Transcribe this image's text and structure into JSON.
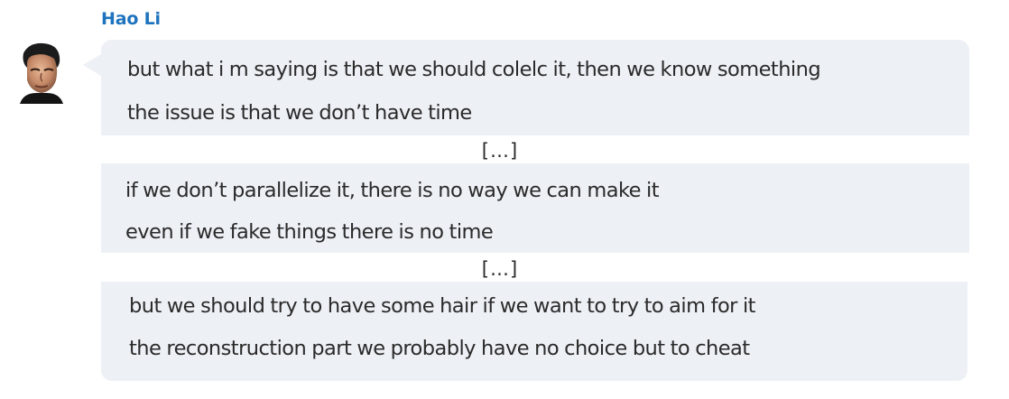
{
  "sender": {
    "name": "Hao Li",
    "avatar_icon": "user-avatar-photo"
  },
  "colors": {
    "name": "#1e73be",
    "bubble": "#edf0f5",
    "text": "#2a2a2a"
  },
  "messages": [
    {
      "lines": [
        "but what i m saying is that we should colelc it, then we know something",
        "the issue is that we don’t have time"
      ]
    },
    {
      "lines": [
        "if we don’t parallelize it, there is no way we can make it",
        "even if we fake things there is no time"
      ]
    },
    {
      "lines": [
        "but we should try to have some hair if we want to try to aim for it",
        "the reconstruction part we probably have no choice but to cheat"
      ]
    }
  ],
  "separators": [
    "[…]",
    "[…]"
  ]
}
